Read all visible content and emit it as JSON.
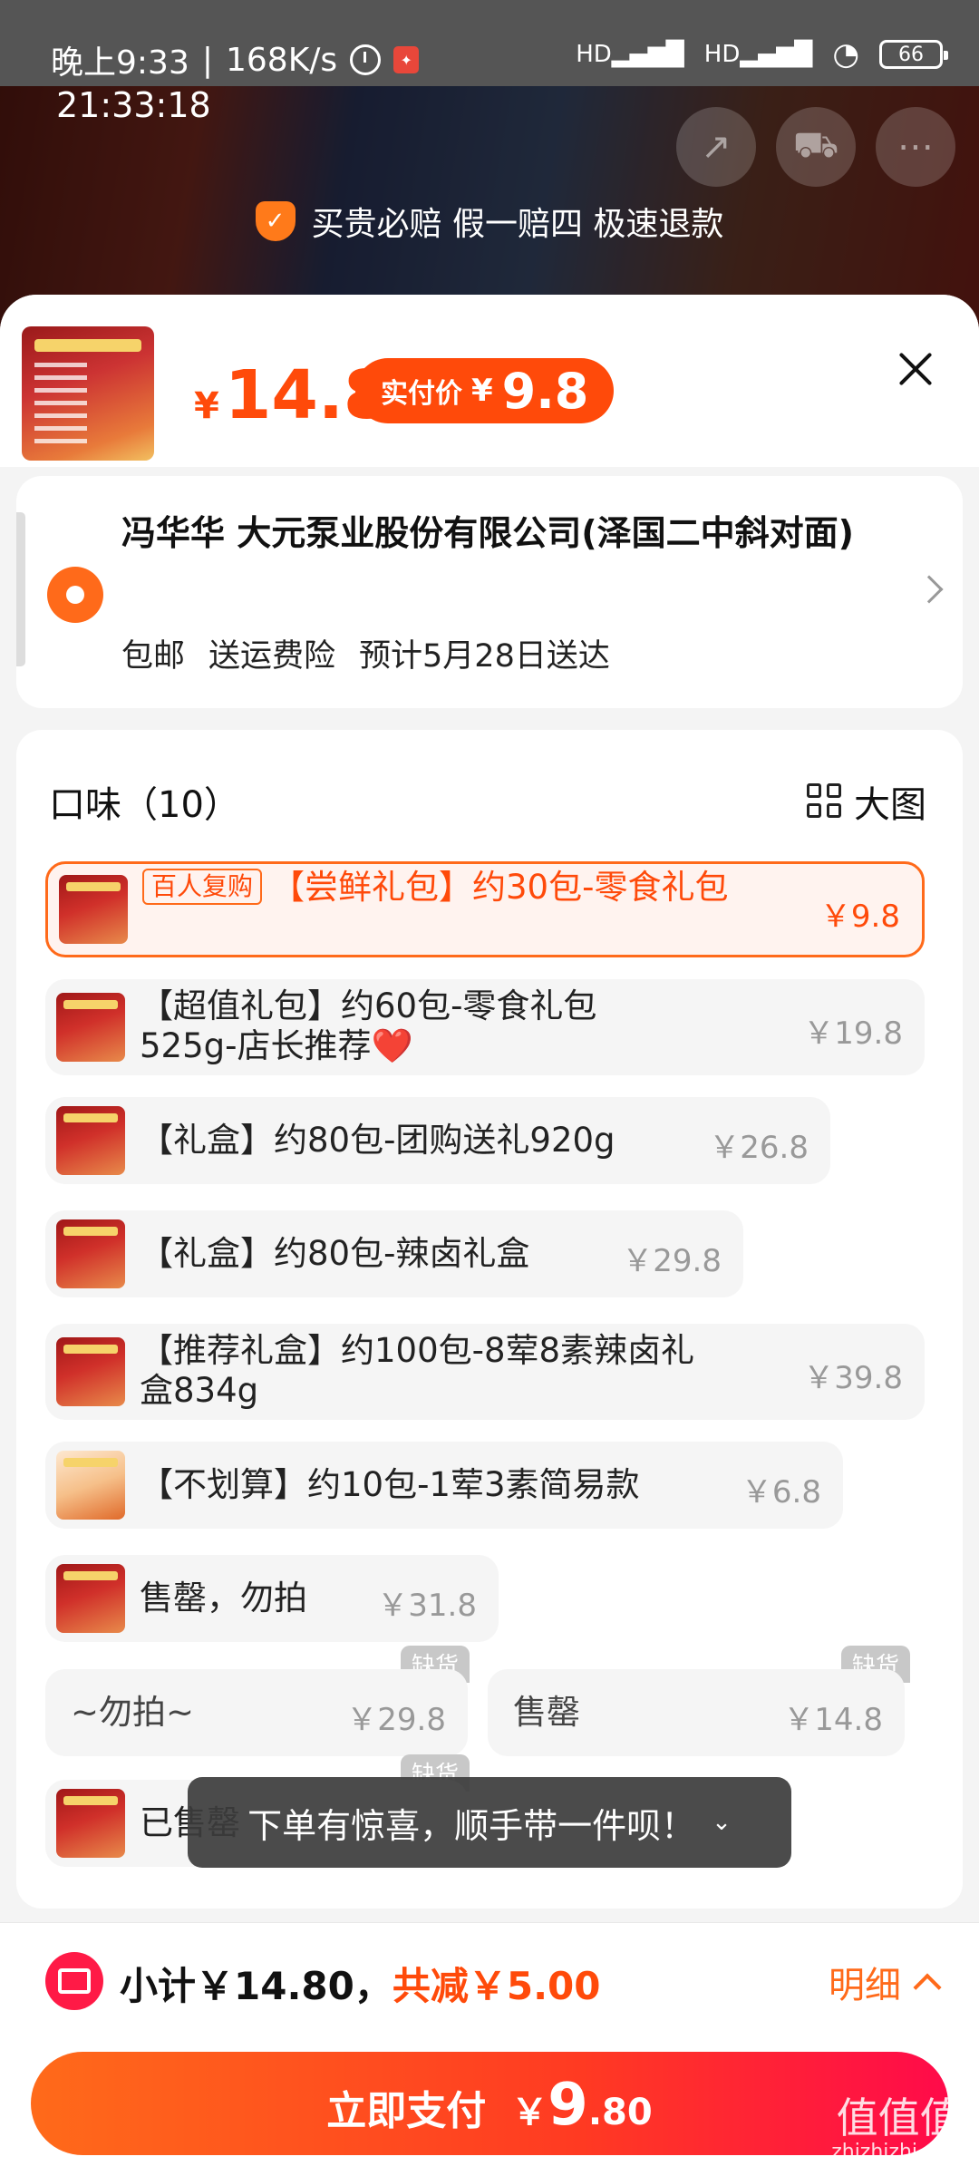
{
  "status_bar": {
    "time": "晚上9:33",
    "speed": "168K/s",
    "clock_overlay": "21:33:18",
    "signal1": "HD",
    "signal2": "HD",
    "battery": "66"
  },
  "guarantee_text": "买贵必赔 假一赔四 极速退款",
  "product": {
    "currency": "¥",
    "price": "14.8",
    "actual_label": "实付价",
    "actual_currency": "¥",
    "actual_price": "9.8"
  },
  "address": {
    "name": "冯华华 大元泵业股份有限公司(泽国二中斜对面)",
    "ship_free": "包邮",
    "insurance": "送运费险",
    "eta": "预计5月28日送达"
  },
  "options": {
    "title": "口味（10）",
    "bigview_label": "大图",
    "items": [
      {
        "tag": "百人复购",
        "name": "【尝鲜礼包】约30包-零食礼包",
        "price": "￥9.8"
      },
      {
        "name": "【超值礼包】约60包-零食礼包525g-店长推荐❤️",
        "price": "￥19.8"
      },
      {
        "name": "【礼盒】约80包-团购送礼920g",
        "price": "￥26.8"
      },
      {
        "name": "【礼盒】约80包-辣卤礼盒",
        "price": "￥29.8"
      },
      {
        "name": "【推荐礼盒】约100包-8荤8素辣卤礼盒834g",
        "price": "￥39.8"
      },
      {
        "name": "【不划算】约10包-1荤3素简易款",
        "price": "￥6.8"
      },
      {
        "name": "售罄，勿拍",
        "price": "￥31.8"
      },
      {
        "name": "~勿拍~",
        "price": "￥29.8",
        "stock": "缺货"
      },
      {
        "name": "售罄",
        "price": "￥14.8",
        "stock": "缺货"
      },
      {
        "name": "已售罄",
        "stock": "缺货"
      }
    ]
  },
  "toast": {
    "text": "下单有惊喜，顺手带一件呗！",
    "chevron": "⌄"
  },
  "bottom": {
    "subtotal": "小计￥14.80，",
    "reduce": "共减￥5.00",
    "detail": "明细"
  },
  "pay": {
    "label": "立即支付",
    "currency": "￥",
    "int": "9",
    "dec": ".80"
  },
  "watermark": {
    "big": "值值值",
    "small": "zhizhizhi.com"
  }
}
